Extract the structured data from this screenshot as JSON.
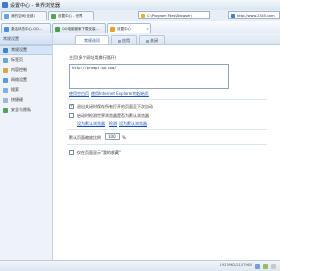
{
  "window": {
    "title": "设置中心 - 世界浏览器"
  },
  "toprow": {
    "tabs": [
      {
        "label": "我的空间(全部)",
        "active": true
      },
      {
        "label": "设置中心 - 世界",
        "active": false
      }
    ],
    "address_left": "C:\\Program Files\\Browser\\",
    "address_right": "http://www.2345.com"
  },
  "browser_tabs": [
    {
      "label": "激活状态中心-QQ..."
    },
    {
      "label": "QQ电脑管家下载安装..."
    },
    {
      "label": "设置中心"
    }
  ],
  "sidebar": {
    "header": "常规设置",
    "items": [
      {
        "label": "常规设置",
        "active": true
      },
      {
        "label": "标签页",
        "active": false
      },
      {
        "label": "内容控制",
        "active": false
      },
      {
        "label": "网络设置",
        "active": false
      },
      {
        "label": "搜索",
        "active": false
      },
      {
        "label": "快捷键",
        "active": false
      },
      {
        "label": "安全与隐私",
        "active": false
      }
    ]
  },
  "content": {
    "tabs": [
      {
        "label": "常规选项",
        "active": true
      },
      {
        "label": "应用",
        "active": false
      },
      {
        "label": "关闭",
        "active": false
      }
    ],
    "homepage_label": "主页(多个网址用换行隔开)",
    "homepage_value": "http://prompt-qq.com/",
    "link_use_current": "使用空白页",
    "link_use_ie": "使用Internet Explorer的起始页",
    "opt_restore": "退出关闭时保存所有打开的页面至下次自动",
    "opt_default_browser": "启动时检测世界浏览器是否为默认浏览器",
    "link_set_default": "设为默认浏览器",
    "link_check_now": "检测",
    "link_mode": "设为默认浏览器",
    "zoom_label": "默认页面缩放比例",
    "zoom_value": "100",
    "zoom_unit": "%",
    "opt_show_favorites": "仅在页面显示收藏夹栏",
    "opt_show_favorites_alt": "仅在页面显示\"我的收藏\""
  },
  "statusbar": {
    "text": "1923962/2107960"
  }
}
